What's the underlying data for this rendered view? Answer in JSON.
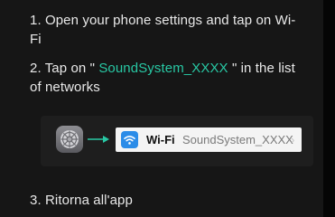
{
  "steps": {
    "step1": {
      "text": "1. Open your phone settings and tap on Wi-Fi"
    },
    "step2": {
      "prefix": "2. Tap on \"",
      "network": " SoundSystem_XXXX ",
      "suffix": "\" in the list of networks"
    },
    "step3": {
      "text": "3. Ritorna all'app"
    }
  },
  "illustration": {
    "settings_icon": "gear-icon",
    "arrow_icon": "arrow-right-icon",
    "wifi_icon": "wifi-icon",
    "wifi_label": "Wi-Fi",
    "network_name": "SoundSystem_XXXX",
    "chevron": "›"
  },
  "colors": {
    "background": "#161616",
    "accent": "#28c8a4",
    "wifi_badge": "#2b8ce8"
  }
}
